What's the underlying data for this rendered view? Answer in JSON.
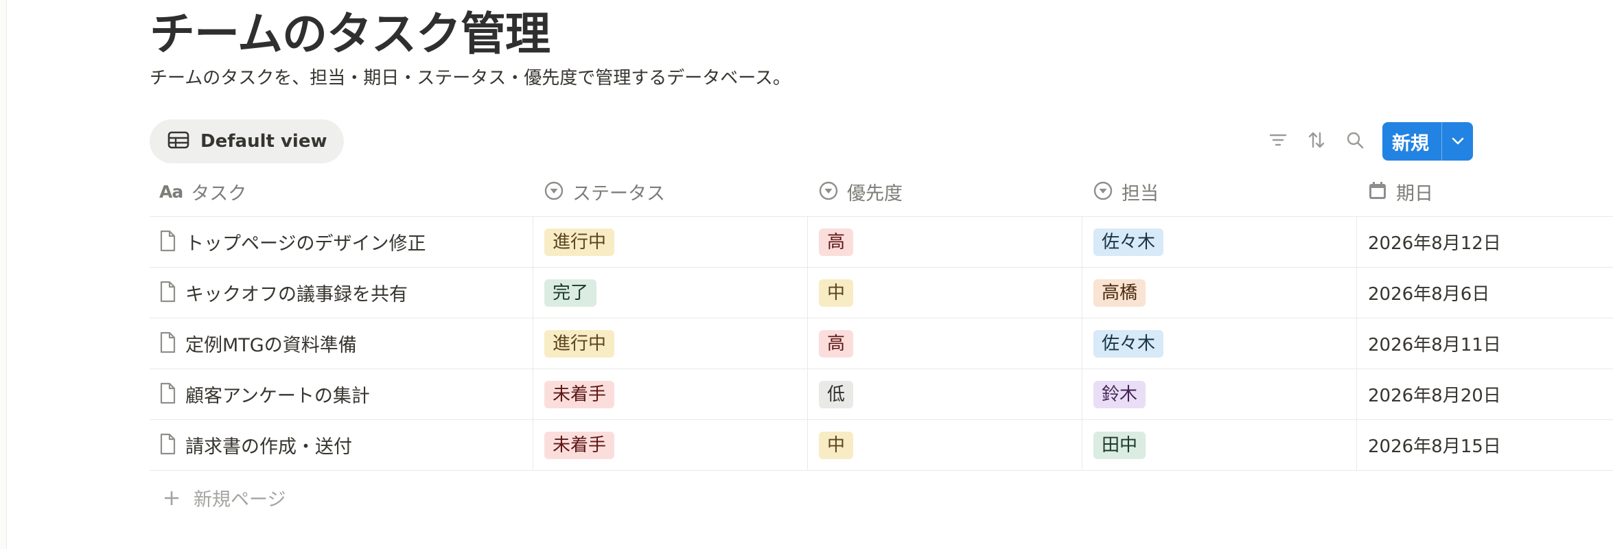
{
  "page": {
    "title": "チームのタスク管理",
    "description": "チームのタスクを、担当・期日・ステータス・優先度で管理するデータベース。"
  },
  "toolbar": {
    "view_label": "Default view",
    "view_icon": "table-icon",
    "filter_icon": "filter-icon",
    "sort_icon": "sort-icon",
    "search_icon": "search-icon",
    "new_label": "新規",
    "new_dropdown_icon": "chevron-down-icon",
    "accent_color": "#2383e2"
  },
  "columns": [
    {
      "label": "タスク",
      "icon": "Aa"
    },
    {
      "label": "ステータス",
      "icon": "select-icon"
    },
    {
      "label": "優先度",
      "icon": "select-icon"
    },
    {
      "label": "担当",
      "icon": "select-icon"
    },
    {
      "label": "期日",
      "icon": "calendar-icon"
    }
  ],
  "rows": [
    {
      "task": "トップページのデザイン修正",
      "status": "進行中",
      "priority": "高",
      "assignee": "佐々木",
      "due": "2026年8月12日"
    },
    {
      "task": "キックオフの議事録を共有",
      "status": "完了",
      "priority": "中",
      "assignee": "高橋",
      "due": "2026年8月6日"
    },
    {
      "task": "定例MTGの資料準備",
      "status": "進行中",
      "priority": "高",
      "assignee": "佐々木",
      "due": "2026年8月11日"
    },
    {
      "task": "顧客アンケートの集計",
      "status": "未着手",
      "priority": "低",
      "assignee": "鈴木",
      "due": "2026年8月20日"
    },
    {
      "task": "請求書の作成・送付",
      "status": "未着手",
      "priority": "中",
      "assignee": "田中",
      "due": "2026年8月15日"
    }
  ],
  "add_row_label": "新規ページ",
  "tag_colors": {
    "進行中": {
      "bg": "#f8ecc5",
      "fg": "#5c4320"
    },
    "完了": {
      "bg": "#dbece2",
      "fg": "#1c3829"
    },
    "未着手": {
      "bg": "#fbdedc",
      "fg": "#5d1715"
    },
    "高": {
      "bg": "#fbdedc",
      "fg": "#5d1715"
    },
    "中": {
      "bg": "#f8ecc5",
      "fg": "#5c4320"
    },
    "低": {
      "bg": "#e9e9e7",
      "fg": "#32302c"
    },
    "佐々木": {
      "bg": "#d8e9f8",
      "fg": "#183347"
    },
    "高橋": {
      "bg": "#f9e3d2",
      "fg": "#49290e"
    },
    "鈴木": {
      "bg": "#e9def6",
      "fg": "#412454"
    },
    "田中": {
      "bg": "#dbece2",
      "fg": "#1c3829"
    }
  }
}
